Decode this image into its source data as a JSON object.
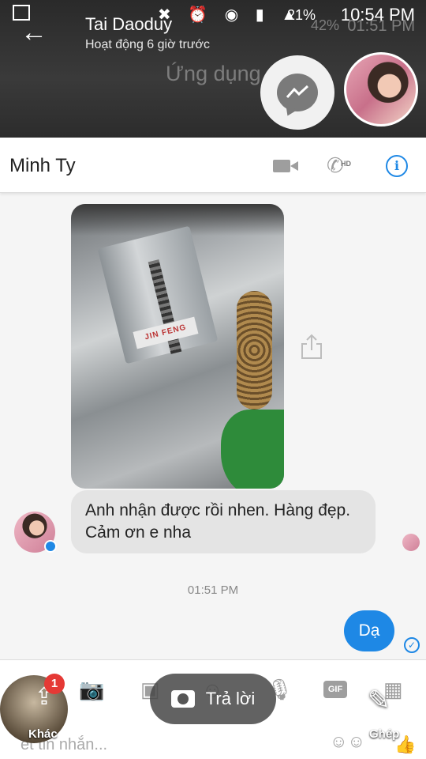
{
  "status_bar": {
    "time": "10:54 PM",
    "battery": "21%"
  },
  "background": {
    "time": "01:51 PM",
    "battery": "42%",
    "app_label": "Ứng dụng"
  },
  "header": {
    "name": "Tai Daoduy",
    "status": "Hoạt động 6 giờ trước"
  },
  "chat": {
    "title": "Minh Ty",
    "messages": {
      "photo_label": "JIN FENG",
      "incoming_text": "Anh nhận được rồi nhen. Hàng đẹp. Cảm ơn e nha",
      "timestamp": "01:51 PM",
      "outgoing_text": "Dạ"
    },
    "composer": {
      "placeholder": "ết tin nhắn..."
    }
  },
  "overlay": {
    "left_label": "Khác",
    "left_badge": "1",
    "reply_label": "Trả lời",
    "right_label": "Ghép"
  },
  "colors": {
    "accent": "#1e88e5",
    "badge": "#e53935"
  }
}
